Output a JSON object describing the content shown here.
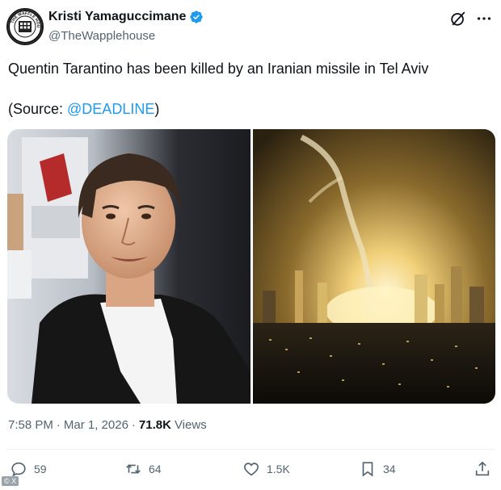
{
  "author": {
    "display_name": "Kristi Yamaguccimane",
    "handle": "@TheWapplehouse",
    "verified": true,
    "avatar_icon": "waffle-house-seal-icon",
    "avatar_seal_text": "THE WAFFLE HOUSE"
  },
  "header_icons": {
    "grok": "grok-icon",
    "more": "more-icon"
  },
  "tweet": {
    "text": "Quentin Tarantino has been killed by an Iranian missile in Tel Aviv",
    "source_prefix": "(Source: ",
    "source_mention": "@DEADLINE",
    "source_suffix": ")"
  },
  "media": {
    "left_image": "portrait-photo",
    "right_image": "night-city-missile-explosion-photo"
  },
  "meta": {
    "time": "7:58 PM",
    "separator": "·",
    "date": "Mar 1, 2026",
    "views_count": "71.8K",
    "views_label": "Views"
  },
  "actions": {
    "replies": "59",
    "reposts": "64",
    "likes": "1.5K",
    "bookmarks": "34"
  },
  "watermark": "© X",
  "colors": {
    "accent": "#1d9bf0",
    "text": "#0f1419",
    "secondary": "#536471"
  }
}
